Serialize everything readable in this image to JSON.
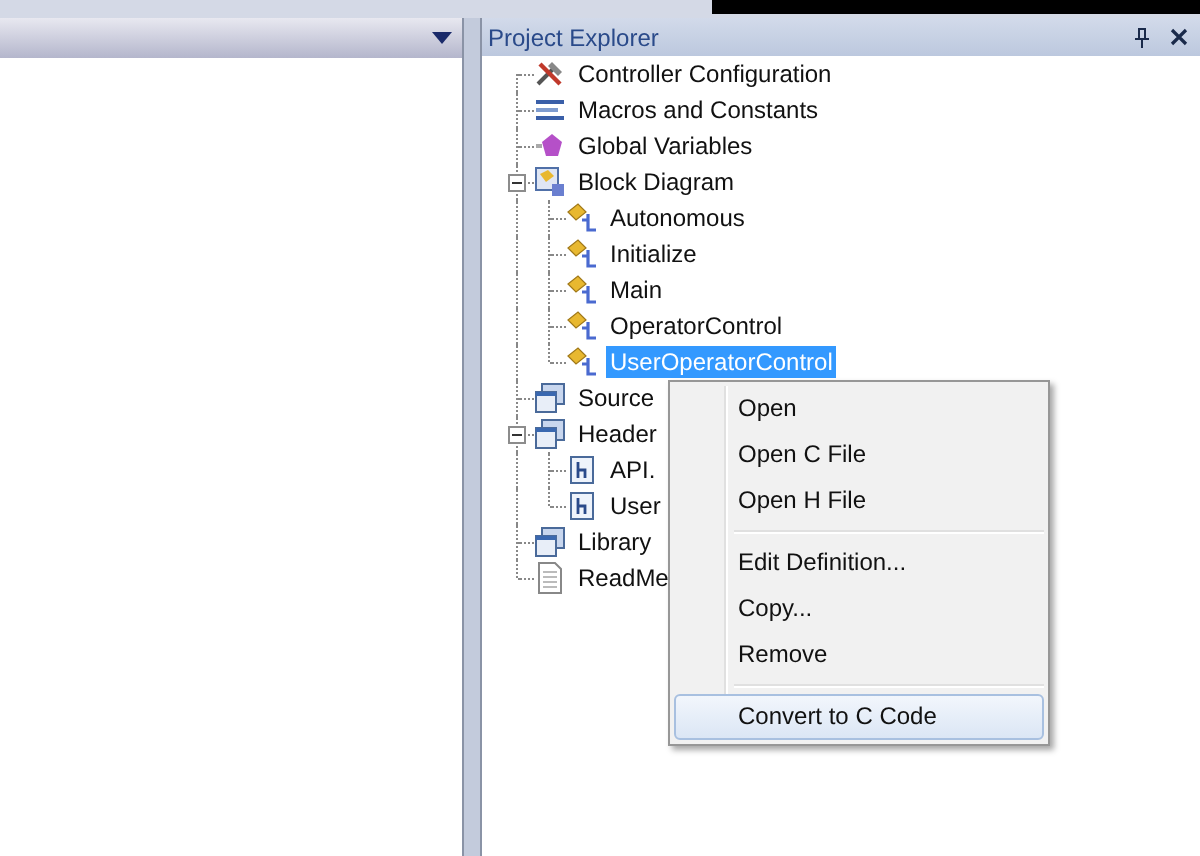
{
  "panel": {
    "title": "Project Explorer"
  },
  "tree": [
    {
      "kind": "tools",
      "label": "Controller Configuration",
      "selected": false
    },
    {
      "kind": "macros",
      "label": "Macros and Constants",
      "selected": false
    },
    {
      "kind": "variables",
      "label": "Global Variables",
      "selected": false
    },
    {
      "kind": "diagram",
      "label": "Block Diagram",
      "selected": false,
      "expanded": true,
      "children": [
        {
          "kind": "block",
          "label": "Autonomous",
          "selected": false
        },
        {
          "kind": "block",
          "label": "Initialize",
          "selected": false
        },
        {
          "kind": "block",
          "label": "Main",
          "selected": false
        },
        {
          "kind": "block",
          "label": "OperatorControl",
          "selected": false
        },
        {
          "kind": "block",
          "label": "UserOperatorControl",
          "selected": true
        }
      ]
    },
    {
      "kind": "folder",
      "label": "Source",
      "selected": false
    },
    {
      "kind": "folder",
      "label": "Header",
      "selected": false,
      "expanded": true,
      "children": [
        {
          "kind": "header-file",
          "label": "API.",
          "selected": false
        },
        {
          "kind": "header-file",
          "label": "User",
          "selected": false
        }
      ]
    },
    {
      "kind": "folder",
      "label": "Library",
      "selected": false
    },
    {
      "kind": "text-file",
      "label": "ReadMe",
      "selected": false
    }
  ],
  "context_menu": {
    "groups": [
      [
        {
          "label": "Open",
          "selected": false
        },
        {
          "label": "Open C File",
          "selected": false
        },
        {
          "label": "Open H File",
          "selected": false
        }
      ],
      [
        {
          "label": "Edit Definition...",
          "selected": false
        },
        {
          "label": "Copy...",
          "selected": false
        },
        {
          "label": "Remove",
          "selected": false
        }
      ],
      [
        {
          "label": "Convert to C Code",
          "selected": true
        }
      ]
    ]
  }
}
